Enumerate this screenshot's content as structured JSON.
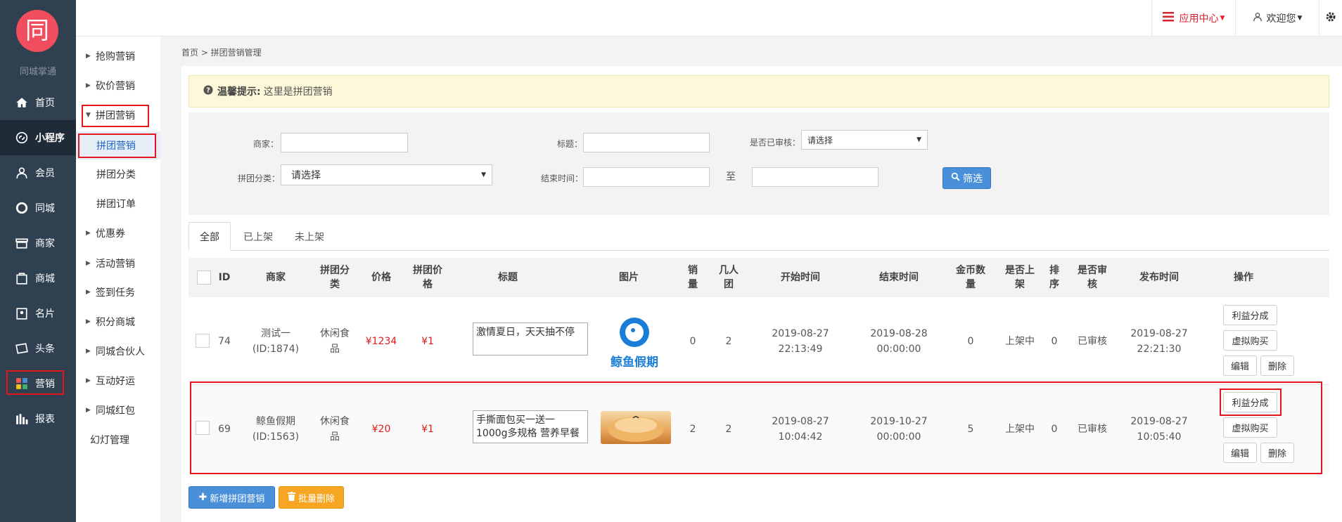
{
  "brand": {
    "logo_char": "同",
    "name": "同城掌通"
  },
  "main_nav": [
    {
      "label": "首页",
      "icon": "home-icon"
    },
    {
      "label": "小程序",
      "icon": "miniapp-icon"
    },
    {
      "label": "会员",
      "icon": "user-icon"
    },
    {
      "label": "同城",
      "icon": "circle-icon"
    },
    {
      "label": "商家",
      "icon": "store-icon"
    },
    {
      "label": "商城",
      "icon": "mall-icon"
    },
    {
      "label": "名片",
      "icon": "card-icon"
    },
    {
      "label": "头条",
      "icon": "news-icon"
    },
    {
      "label": "营销",
      "icon": "marketing-icon"
    },
    {
      "label": "报表",
      "icon": "chart-icon"
    }
  ],
  "sub_nav": [
    {
      "label": "抢购营销"
    },
    {
      "label": "砍价营销"
    },
    {
      "label": "拼团营销"
    },
    {
      "label": "拼团营销"
    },
    {
      "label": "拼团分类"
    },
    {
      "label": "拼团订单"
    },
    {
      "label": "优惠券"
    },
    {
      "label": "活动营销"
    },
    {
      "label": "签到任务"
    },
    {
      "label": "积分商城"
    },
    {
      "label": "同城合伙人"
    },
    {
      "label": "互动好运"
    },
    {
      "label": "同城红包"
    },
    {
      "label": "幻灯管理"
    }
  ],
  "topbar": {
    "app_center": "应用中心",
    "welcome": "欢迎您"
  },
  "breadcrumb": "首页 > 拼团营销管理",
  "tip": {
    "label": "温馨提示:",
    "text": "这里是拼团营销"
  },
  "filter": {
    "merchant_label": "商家：",
    "title_label": "标题：",
    "reviewed_label": "是否已审核：",
    "reviewed_value": "请选择",
    "category_label": "拼团分类：",
    "category_value": "请选择",
    "endtime_label": "结束时间：",
    "to_label": "至",
    "button": "筛选"
  },
  "tabs": [
    "全部",
    "已上架",
    "未上架"
  ],
  "columns": [
    "ID",
    "商家",
    "拼团分类",
    "价格",
    "拼团价格",
    "标题",
    "图片",
    "销量",
    "几人团",
    "开始时间",
    "结束时间",
    "金币数量",
    "是否上架",
    "排序",
    "是否审核",
    "发布时间",
    "操作"
  ],
  "column_lines": {
    "category": [
      "拼团分",
      "类"
    ],
    "group_price": [
      "拼团价",
      "格"
    ],
    "sales": [
      "销",
      "量"
    ],
    "group_size": [
      "几人",
      "团"
    ],
    "coins": [
      "金币数",
      "量"
    ],
    "listed": [
      "是否上",
      "架"
    ],
    "sort": [
      "排",
      "序"
    ],
    "reviewed": [
      "是否审",
      "核"
    ]
  },
  "rows": [
    {
      "id": "74",
      "merchant": [
        "测试一(ID:1874)"
      ],
      "category": [
        "休闲食",
        "品"
      ],
      "price": "¥1234",
      "group_price": "¥1",
      "title": "激情夏日，天天抽不停",
      "image_text": "鲸鱼假期",
      "sales": "0",
      "group_size": "2",
      "start": [
        "2019-08-27",
        "22:13:49"
      ],
      "end": [
        "2019-08-28",
        "00:00:00"
      ],
      "coins": "0",
      "listed": "上架中",
      "sort": "0",
      "reviewed": "已审核",
      "published": [
        "2019-08-27",
        "22:21:30"
      ]
    },
    {
      "id": "69",
      "merchant": [
        "鲸鱼假期",
        "(ID:1563)"
      ],
      "category": [
        "休闲食",
        "品"
      ],
      "price": "¥20",
      "group_price": "¥1",
      "title": "手撕面包买一送一 1000g多规格 营养早餐",
      "image_text": "",
      "sales": "2",
      "group_size": "2",
      "start": [
        "2019-08-27",
        "10:04:42"
      ],
      "end": [
        "2019-10-27",
        "00:00:00"
      ],
      "coins": "5",
      "listed": "上架中",
      "sort": "0",
      "reviewed": "已审核",
      "published": [
        "2019-08-27",
        "10:05:40"
      ]
    }
  ],
  "row_actions": {
    "profit": "利益分成",
    "virtual": "虚拟购买",
    "edit": "编辑",
    "delete": "删除"
  },
  "footer_buttons": {
    "add": "新增拼团营销",
    "batch_delete": "批量删除"
  },
  "colors": {
    "sidebar": "#2f4050",
    "accent_red": "#e3161d",
    "primary_blue": "#4a90d9",
    "warning_orange": "#f6a623"
  }
}
